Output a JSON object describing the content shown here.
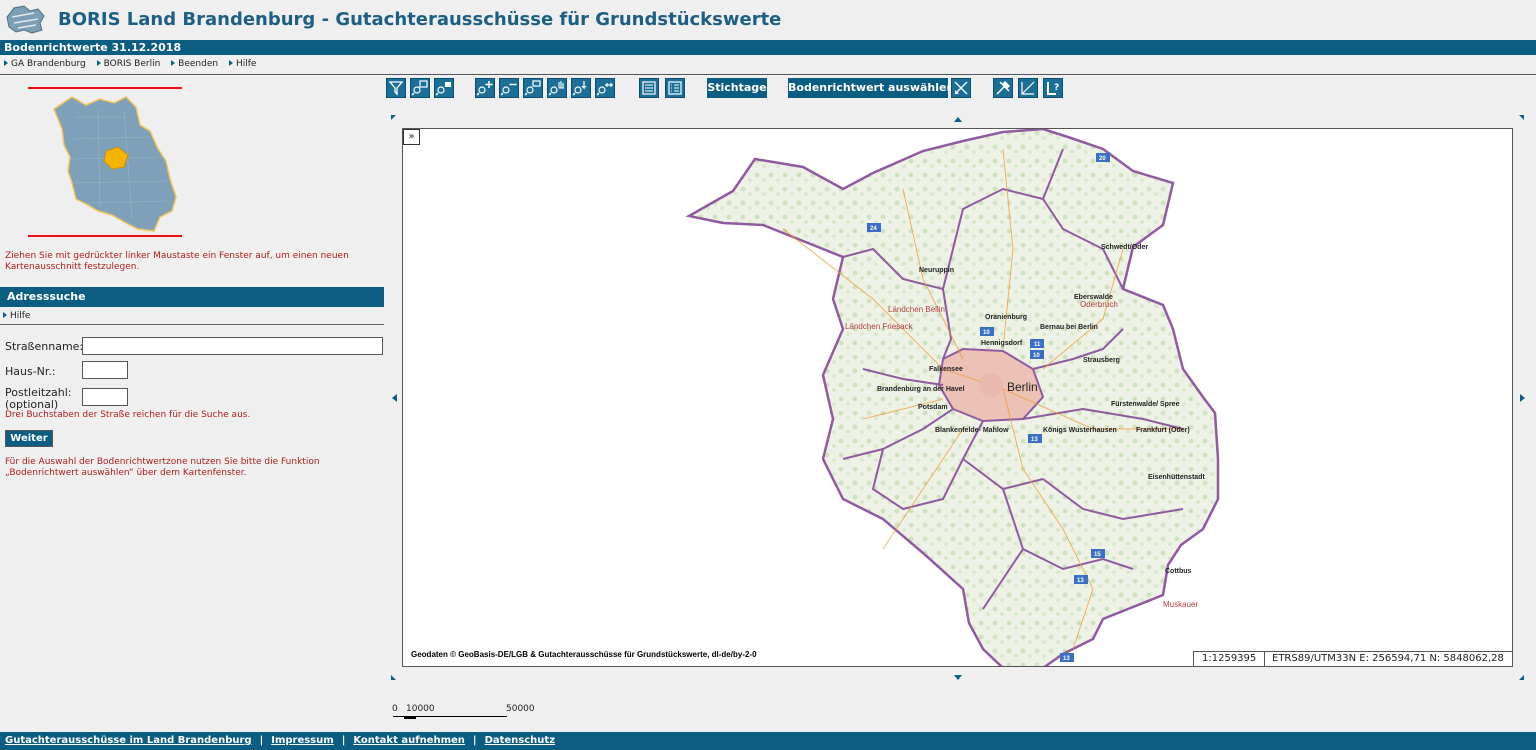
{
  "header": {
    "title": "BORIS Land Brandenburg - Gutachterausschüsse für Grundstückswerte",
    "subtitle": "Bodenrichtwerte 31.12.2018"
  },
  "topnav": [
    {
      "label": "GA Brandenburg"
    },
    {
      "label": "BORIS Berlin"
    },
    {
      "label": "Beenden"
    },
    {
      "label": "Hilfe"
    }
  ],
  "left": {
    "hint": "Ziehen Sie mit gedrückter linker Maustaste ein Fenster auf, um einen neuen Kartenausschnitt festzulegen.",
    "address": {
      "title": "Adresssuche",
      "help": "Hilfe",
      "street_label": "Straßenname:",
      "street_value": "",
      "housenr_label": "Haus-Nr.:",
      "housenr_value": "",
      "plz_label": "Postleitzahl:",
      "plz_label2": "(optional)",
      "plz_value": "",
      "search_hint": "Drei Buchstaben der Straße reichen für die Suche aus.",
      "submit_label": "Weiter",
      "zone_hint": "Für die Auswahl der Bodenrichtwertzone nutzen Sie bitte die Funktion „Bodenrichtwert auswählen“ über dem Kartenfenster."
    }
  },
  "toolbar": {
    "stichtage_label": "Stichtage",
    "select_label": "Bodenrichtwert auswählen"
  },
  "map": {
    "toggle_label": "»",
    "copyright": "Geodaten © GeoBasis-DE/LGB & Gutachterausschüsse für Grundstückswerte, dl-de/by-2-0",
    "scale": "1:1259395",
    "coords": "ETRS89/UTM33N E: 256594,71 N: 5848062,28",
    "places": {
      "berlin": "Berlin",
      "potsdam": "Potsdam",
      "schwedt": "Schwedt/Oder",
      "neuruppin": "Neuruppin",
      "oranienburg": "Oranienburg",
      "eberswalde": "Eberswalde",
      "strausberg": "Strausberg",
      "falkensee": "Falkensee",
      "hennigsdorf": "Hennigsdorf",
      "bernau": "Bernau bei Berlin",
      "brandenburg": "Brandenburg an der Havel",
      "fuerstenwalde": "Fürstenwalde/ Spree",
      "frankfurt": "Frankfurt (Oder)",
      "eisenhuettenstadt": "Eisenhüttenstadt",
      "koenigs": "Königs Wusterhausen",
      "blankenfelde": "Blankenfelde- Mahlow",
      "cottbus": "Cottbus",
      "muskauer": "Muskauer",
      "laendchen_bellin": "Ländchen Bellin",
      "laendchen_friesack": "Ländchen Friesack",
      "oderbruch": "Oderbruch"
    },
    "shields": [
      "20",
      "24",
      "10",
      "11",
      "10",
      "13",
      "15",
      "13",
      "13"
    ]
  },
  "scalebar": {
    "zero": "0",
    "mid": "10000",
    "end": "50000"
  },
  "footer": {
    "links": [
      "Gutachterausschüsse im Land Brandenburg",
      "Impressum",
      "Kontakt aufnehmen",
      "Datenschutz"
    ]
  },
  "colors": {
    "primary": "#0b5d82",
    "title": "#1d5f82",
    "hint_red": "#b02020",
    "boundary": "#8f5aa0",
    "highlight": "#f5b400"
  }
}
